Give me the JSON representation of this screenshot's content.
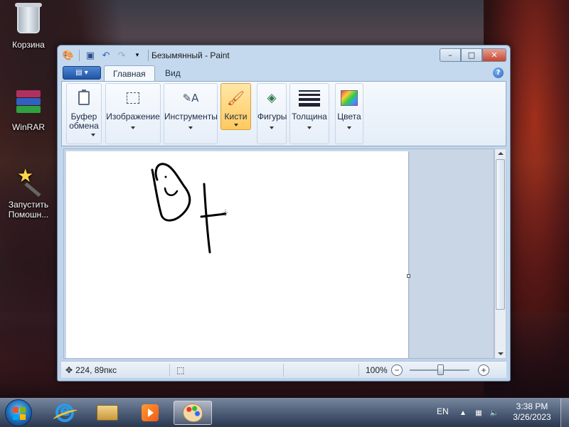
{
  "desktop": {
    "icons": [
      {
        "label": "Корзина",
        "icon": "recycle-bin-icon"
      },
      {
        "label": "WinRAR",
        "icon": "winrar-icon"
      },
      {
        "label": "Запустить Помошн...",
        "icon": "wizard-wand-icon"
      }
    ]
  },
  "window": {
    "title": "Безымянный - Paint",
    "controls": {
      "minimize": "–",
      "maximize": "□",
      "close": "✕"
    },
    "help": "?"
  },
  "ribbon": {
    "tabs": [
      {
        "label": "Главная",
        "active": true
      },
      {
        "label": "Вид",
        "active": false
      }
    ],
    "groups": [
      {
        "label": "Буфер обмена",
        "icon": "clipboard-icon"
      },
      {
        "label": "Изображение",
        "icon": "select-icon"
      },
      {
        "label": "Инструменты",
        "icon": "tools-icon"
      },
      {
        "label": "Кисти",
        "icon": "brush-icon",
        "active": true
      },
      {
        "label": "Фигуры",
        "icon": "shapes-icon"
      },
      {
        "label": "Толщина",
        "icon": "line-width-icon"
      },
      {
        "label": "Цвета",
        "icon": "palette-icon"
      }
    ]
  },
  "statusbar": {
    "cursor_position": "224, 89пкс",
    "zoom": "100%"
  },
  "taskbar": {
    "lang": "EN",
    "time": "3:38 PM",
    "date": "3/26/2023",
    "pinned": [
      "internet-explorer-icon",
      "explorer-icon",
      "media-player-icon",
      "paint-icon"
    ]
  },
  "colors": {
    "window_frame": "#c5d9ee",
    "brush_active": "#ffc95e",
    "file_button": "#1f55a8"
  }
}
